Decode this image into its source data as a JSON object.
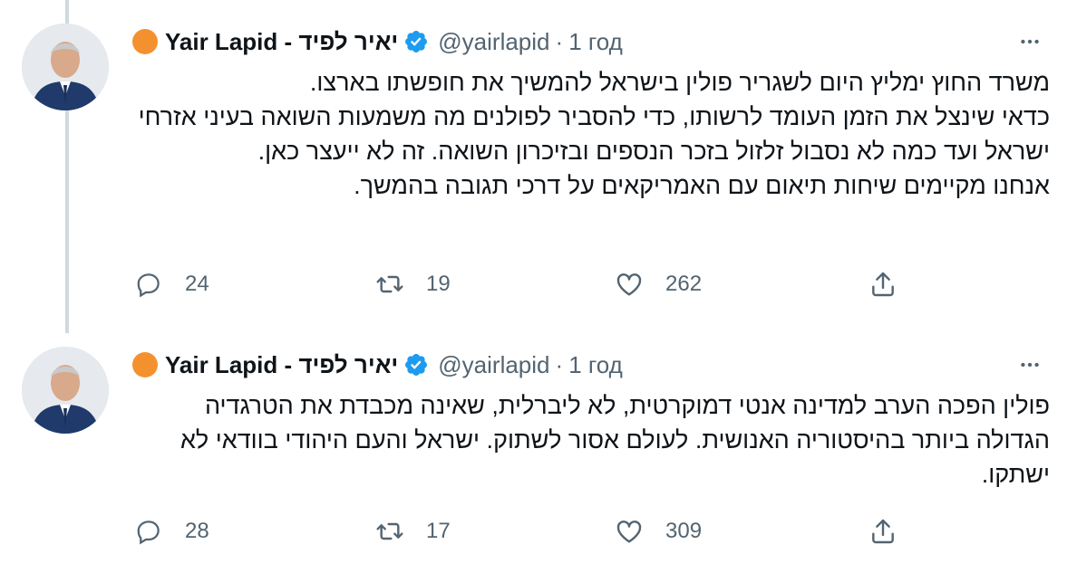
{
  "tweets": [
    {
      "author": {
        "display_name": "Yair Lapid - יאיר לפיד",
        "handle": "@yairlapid",
        "separator": "·",
        "time": "1 год"
      },
      "text": "משרד החוץ ימליץ היום לשגריר פולין בישראל להמשיך את  חופשתו בארצו.\nכדאי שינצל את הזמן העומד לרשותו, כדי להסביר לפולנים מה משמעות השואה בעיני אזרחי ישראל  ועד כמה לא נסבול זלזול בזכר הנספים ובזיכרון השואה. זה לא ייעצר כאן.\nאנחנו מקיימים שיחות תיאום עם האמריקאים על דרכי תגובה בהמשך.",
      "reply_count": "24",
      "retweet_count": "19",
      "like_count": "262"
    },
    {
      "author": {
        "display_name": "Yair Lapid - יאיר לפיד",
        "handle": "@yairlapid",
        "separator": "·",
        "time": "1 год"
      },
      "text": "פולין הפכה הערב למדינה אנטי דמוקרטית, לא ליברלית, שאינה מכבדת את הטרגדיה הגדולה ביותר בהיסטוריה האנושית. לעולם אסור לשתוק. ישראל והעם היהודי בוודאי לא ישתקו.",
      "reply_count": "28",
      "retweet_count": "17",
      "like_count": "309"
    }
  ],
  "icons": {
    "status_dot": "orange-circle",
    "verified": "verified-badge-icon",
    "more": "more-horizontal-icon",
    "reply": "reply-icon",
    "retweet": "retweet-icon",
    "like": "heart-icon",
    "share": "share-icon"
  },
  "colors": {
    "accent": "#1d9bf0",
    "status_dot": "#f4912f",
    "muted": "#536471",
    "text": "#0f1419",
    "thread_line": "#cfd9de"
  }
}
